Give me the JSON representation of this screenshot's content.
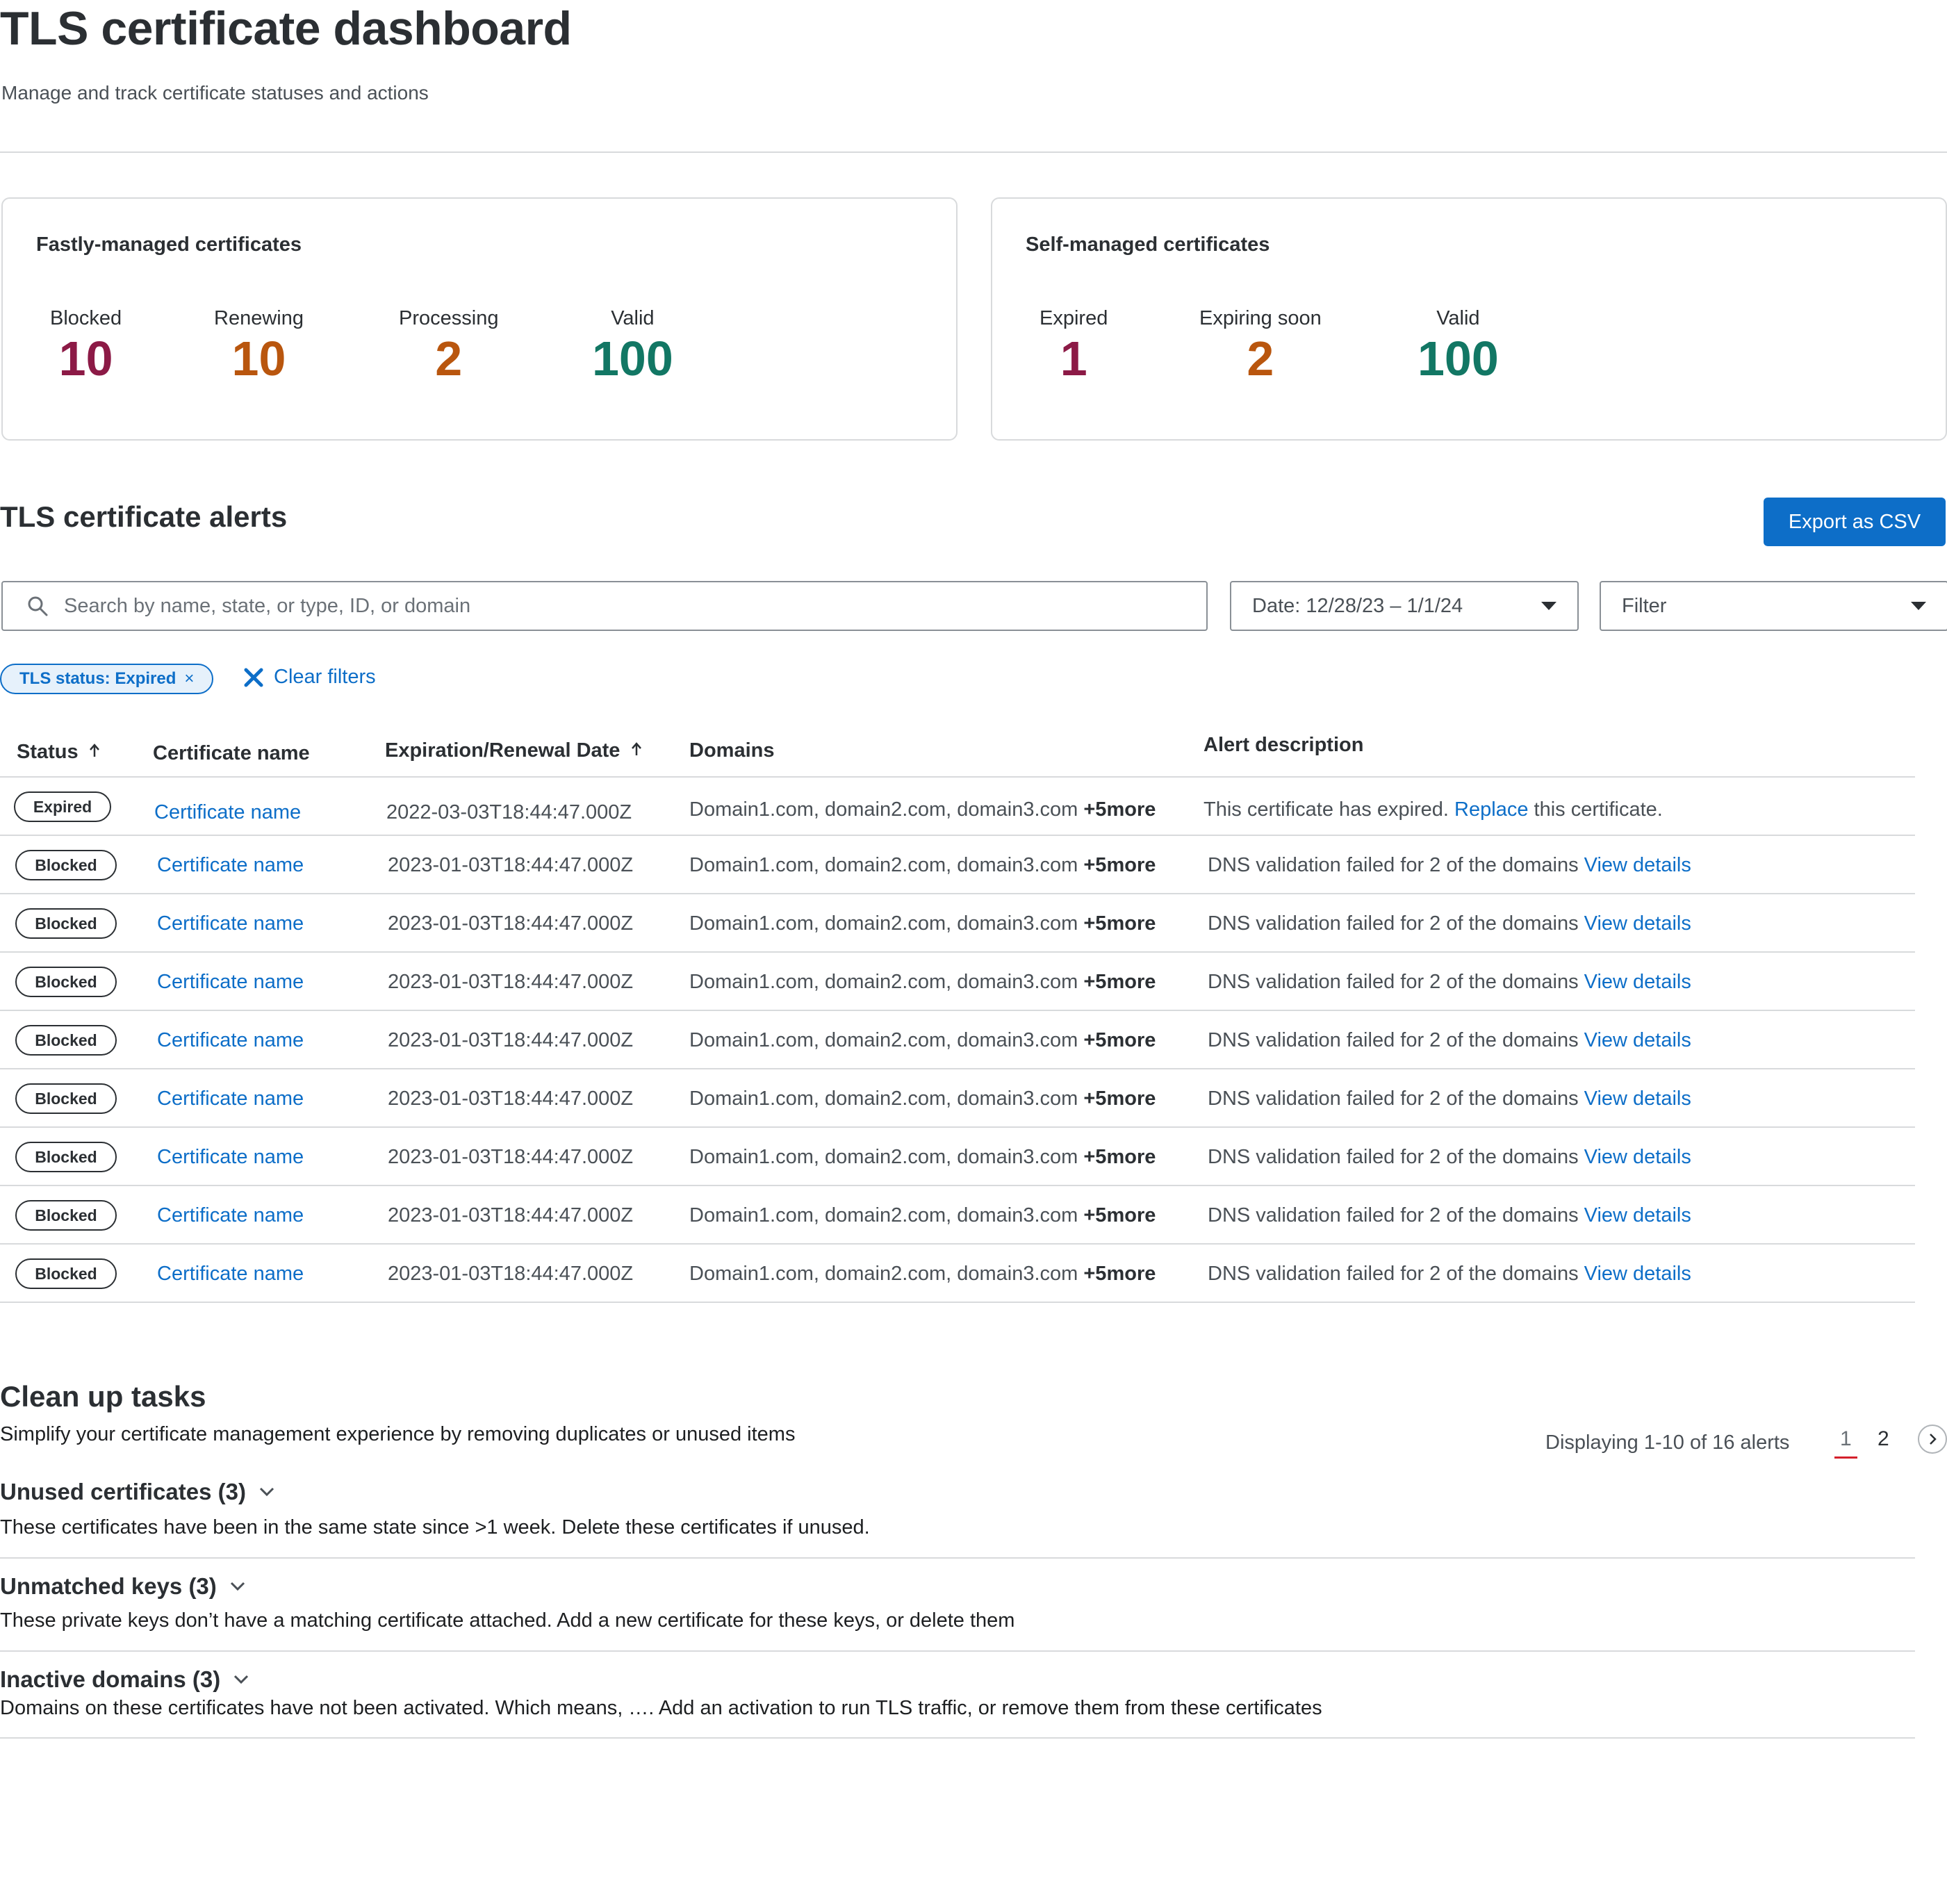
{
  "header": {
    "title": "TLS certificate dashboard",
    "subtitle": "Manage and track certificate statuses and actions"
  },
  "fastly_card": {
    "title": "Fastly-managed certificates",
    "stats": [
      {
        "label": "Blocked",
        "value": "10"
      },
      {
        "label": "Renewing",
        "value": "10"
      },
      {
        "label": "Processing",
        "value": "2"
      },
      {
        "label": "Valid",
        "value": "100"
      }
    ]
  },
  "self_card": {
    "title": "Self-managed certificates",
    "stats": [
      {
        "label": "Expired",
        "value": "1"
      },
      {
        "label": "Expiring soon",
        "value": "2"
      },
      {
        "label": "Valid",
        "value": "100"
      }
    ]
  },
  "colors": {
    "blocked": "#8c1a46",
    "warning": "#b9560e",
    "valid": "#127764",
    "accent": "#0d6ec8"
  },
  "alerts": {
    "title": "TLS certificate alerts",
    "export_label": "Export as CSV",
    "search_placeholder": "Search by name, state, or type, ID, or domain",
    "date_filter": "Date: 12/28/23 – 1/1/24",
    "filter_label": "Filter",
    "chip_label": "TLS status: Expired",
    "chip_close": "×",
    "clear_filters": "Clear filters",
    "columns": {
      "status": "Status",
      "name": "Certificate name",
      "date": "Expiration/Renewal Date",
      "domains": "Domains",
      "description": "Alert description"
    },
    "rows": [
      {
        "status": "Expired",
        "name": "Certificate name",
        "date": "2022-03-03T18:44:47.000Z",
        "domains": "Domain1.com, domain2.com, domain3.com",
        "more": "+5more",
        "desc": "This certificate has expired.",
        "link": "Replace",
        "desc_after": "this certificate."
      },
      {
        "status": "Blocked",
        "name": "Certificate name",
        "date": "2023-01-03T18:44:47.000Z",
        "domains": "Domain1.com, domain2.com, domain3.com",
        "more": "+5more",
        "desc": "DNS validation failed for 2 of the domains",
        "link": "View details",
        "desc_after": ""
      },
      {
        "status": "Blocked",
        "name": "Certificate name",
        "date": "2023-01-03T18:44:47.000Z",
        "domains": "Domain1.com, domain2.com, domain3.com",
        "more": "+5more",
        "desc": "DNS validation failed for 2 of the domains",
        "link": "View details",
        "desc_after": ""
      },
      {
        "status": "Blocked",
        "name": "Certificate name",
        "date": "2023-01-03T18:44:47.000Z",
        "domains": "Domain1.com, domain2.com, domain3.com",
        "more": "+5more",
        "desc": "DNS validation failed for 2 of the domains",
        "link": "View details",
        "desc_after": ""
      },
      {
        "status": "Blocked",
        "name": "Certificate name",
        "date": "2023-01-03T18:44:47.000Z",
        "domains": "Domain1.com, domain2.com, domain3.com",
        "more": "+5more",
        "desc": "DNS validation failed for 2 of the domains",
        "link": "View details",
        "desc_after": ""
      },
      {
        "status": "Blocked",
        "name": "Certificate name",
        "date": "2023-01-03T18:44:47.000Z",
        "domains": "Domain1.com, domain2.com, domain3.com",
        "more": "+5more",
        "desc": "DNS validation failed for 2 of the domains",
        "link": "View details",
        "desc_after": ""
      },
      {
        "status": "Blocked",
        "name": "Certificate name",
        "date": "2023-01-03T18:44:47.000Z",
        "domains": "Domain1.com, domain2.com, domain3.com",
        "more": "+5more",
        "desc": "DNS validation failed for 2 of the domains",
        "link": "View details",
        "desc_after": ""
      },
      {
        "status": "Blocked",
        "name": "Certificate name",
        "date": "2023-01-03T18:44:47.000Z",
        "domains": "Domain1.com, domain2.com, domain3.com",
        "more": "+5more",
        "desc": "DNS validation failed for 2 of the domains",
        "link": "View details",
        "desc_after": ""
      },
      {
        "status": "Blocked",
        "name": "Certificate name",
        "date": "2023-01-03T18:44:47.000Z",
        "domains": "Domain1.com, domain2.com, domain3.com",
        "more": "+5more",
        "desc": "DNS validation failed for 2 of the domains",
        "link": "View details",
        "desc_after": ""
      }
    ]
  },
  "cleanup": {
    "title": "Clean up tasks",
    "subtitle": "Simplify your certificate management experience by removing duplicates or unused items",
    "groups": [
      {
        "title": "Unused certificates (3)",
        "desc": "These certificates have been in the same state since >1 week. Delete these certificates if unused."
      },
      {
        "title": "Unmatched keys (3)",
        "desc": "These private keys don’t have a matching certificate attached. Add a new certificate for these keys, or delete them"
      },
      {
        "title": "Inactive domains (3)",
        "desc": "Domains on these certificates have not been activated. Which means, …. Add an activation to run TLS traffic, or remove them from these certificates"
      }
    ]
  },
  "pagination": {
    "summary": "Displaying 1-10 of 16 alerts",
    "pages": [
      "1",
      "2"
    ],
    "current": "1"
  }
}
